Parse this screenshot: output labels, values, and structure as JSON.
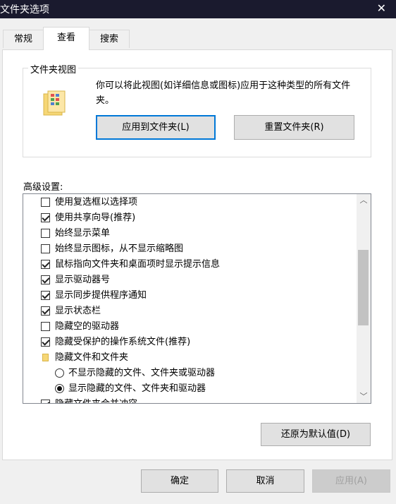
{
  "window": {
    "title": "文件夹选项",
    "close_glyph": "✕"
  },
  "tabs": [
    {
      "label": "常规",
      "active": false
    },
    {
      "label": "查看",
      "active": true
    },
    {
      "label": "搜索",
      "active": false
    }
  ],
  "folder_view": {
    "group_title": "文件夹视图",
    "description": "你可以将此视图(如详细信息或图标)应用于这种类型的所有文件夹。",
    "apply_button": "应用到文件夹(L)",
    "reset_button": "重置文件夹(R)"
  },
  "advanced": {
    "label": "高级设置:",
    "items": [
      {
        "kind": "checkbox",
        "checked": false,
        "label": "使用复选框以选择项"
      },
      {
        "kind": "checkbox",
        "checked": true,
        "label": "使用共享向导(推荐)"
      },
      {
        "kind": "checkbox",
        "checked": false,
        "label": "始终显示菜单"
      },
      {
        "kind": "checkbox",
        "checked": false,
        "label": "始终显示图标，从不显示缩略图"
      },
      {
        "kind": "checkbox",
        "checked": true,
        "label": "鼠标指向文件夹和桌面项时显示提示信息"
      },
      {
        "kind": "checkbox",
        "checked": true,
        "label": "显示驱动器号"
      },
      {
        "kind": "checkbox",
        "checked": true,
        "label": "显示同步提供程序通知"
      },
      {
        "kind": "checkbox",
        "checked": true,
        "label": "显示状态栏"
      },
      {
        "kind": "checkbox",
        "checked": false,
        "label": "隐藏空的驱动器"
      },
      {
        "kind": "checkbox",
        "checked": true,
        "label": "隐藏受保护的操作系统文件(推荐)"
      },
      {
        "kind": "folder",
        "label": "隐藏文件和文件夹"
      },
      {
        "kind": "radio",
        "checked": false,
        "label": "不显示隐藏的文件、文件夹或驱动器"
      },
      {
        "kind": "radio",
        "checked": true,
        "label": "显示隐藏的文件、文件夹和驱动器"
      },
      {
        "kind": "checkbox",
        "checked": true,
        "label": "隐藏文件夹合并冲突"
      }
    ],
    "scroll_up_glyph": "︿",
    "scroll_down_glyph": "﹀"
  },
  "restore_button": "还原为默认值(D)",
  "footer": {
    "ok": "确定",
    "cancel": "取消",
    "apply": "应用(A)",
    "apply_enabled": false
  },
  "colors": {
    "titlebar": "#1a1a2e",
    "focus": "#0078d7",
    "folder": "#f6d776"
  }
}
